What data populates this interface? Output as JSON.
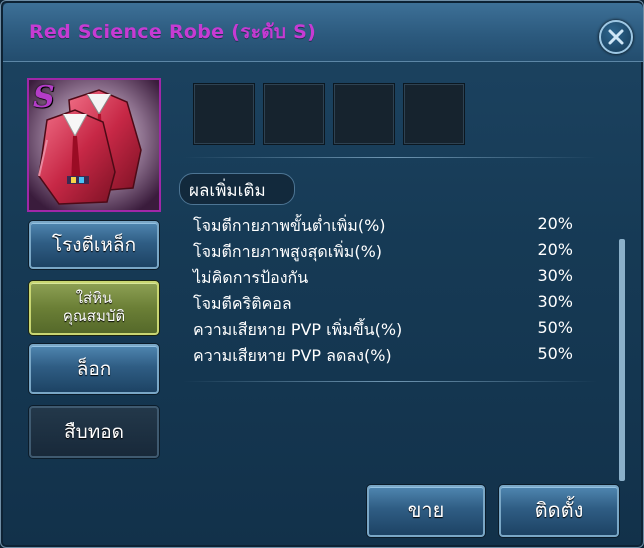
{
  "window": {
    "title": "Red Science Robe (ระดับ S)",
    "close_icon": "close-x-icon"
  },
  "item": {
    "grade": "S",
    "icon": "red-robe-icon",
    "grade_color": "#b43cc8"
  },
  "sockets": [
    {
      "state": "empty"
    },
    {
      "state": "empty"
    },
    {
      "state": "empty"
    },
    {
      "state": "empty"
    }
  ],
  "bonus_section": {
    "title": "ผลเพิ่มเติม",
    "stats": [
      {
        "name": "โจมตีกายภาพขั้นต่ำเพิ่ม(%)",
        "value": "20%"
      },
      {
        "name": "โจมตีกายภาพสูงสุดเพิ่ม(%)",
        "value": "20%"
      },
      {
        "name": "ไม่คิดการป้องกัน",
        "value": "30%"
      },
      {
        "name": "โจมตีคริติคอล",
        "value": "30%"
      },
      {
        "name": "ความเสียหาย PVP เพิ่มขึ้น(%)",
        "value": "50%"
      },
      {
        "name": "ความเสียหาย PVP ลดลง(%)",
        "value": "50%"
      }
    ]
  },
  "side_buttons": {
    "forge": "โรงตีเหล็ก",
    "insert_stone_line1": "ใส่หิน",
    "insert_stone_line2": "คุณสมบัติ",
    "lock": "ล็อก",
    "inherit": "สืบทอด"
  },
  "bottom_buttons": {
    "sell": "ขาย",
    "equip": "ติดตั้ง"
  },
  "colors": {
    "title": "#c63bd3",
    "panel": "#163a55",
    "accent_green": "#6b7f36"
  }
}
